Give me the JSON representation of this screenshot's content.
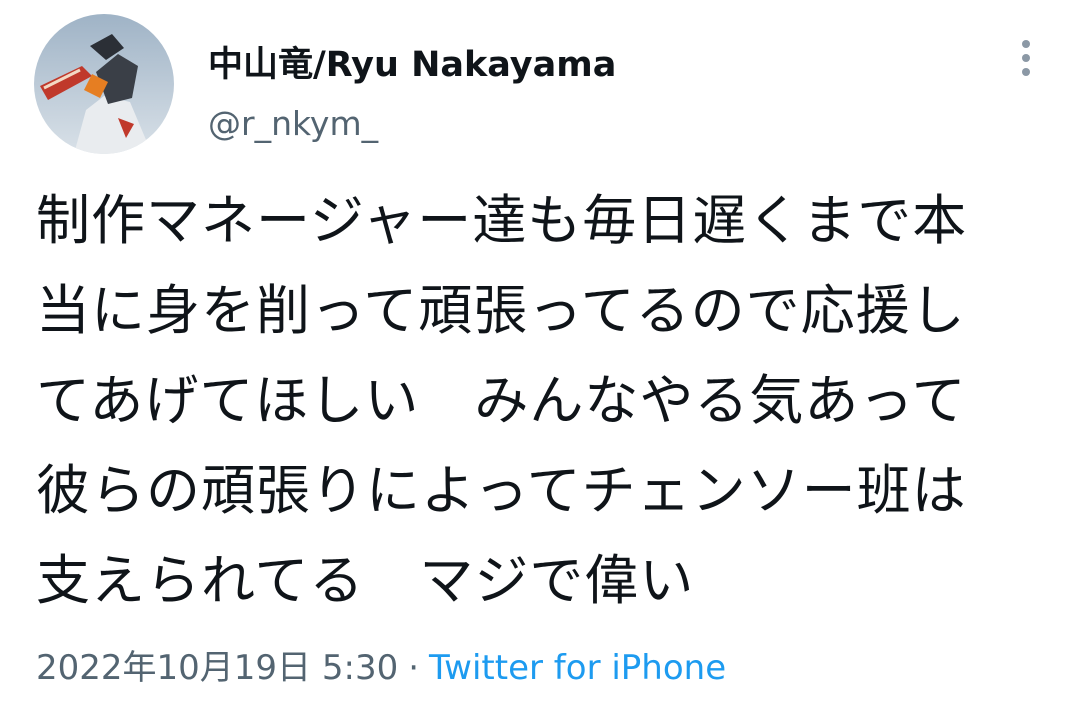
{
  "tweet": {
    "display_name": "中山竜/Ryu Nakayama",
    "handle": "@r_nkym_",
    "body_lines": [
      "制作マネージャー達も毎日遅くまで本",
      "当に身を削って頑張ってるので応援し",
      "てあげてほしい　みんなやる気あって",
      "彼らの頑張りによってチェンソー班は",
      "支えられてる　マジで偉い"
    ],
    "date": "2022年10月19日 5:30",
    "separator": "·",
    "source": "Twitter for iPhone"
  },
  "icons": {
    "more": "more-vertical-icon",
    "avatar": "avatar-chainsaw-character"
  },
  "colors": {
    "text": "#0f1419",
    "secondary": "#536471",
    "link": "#1d9bf0"
  }
}
